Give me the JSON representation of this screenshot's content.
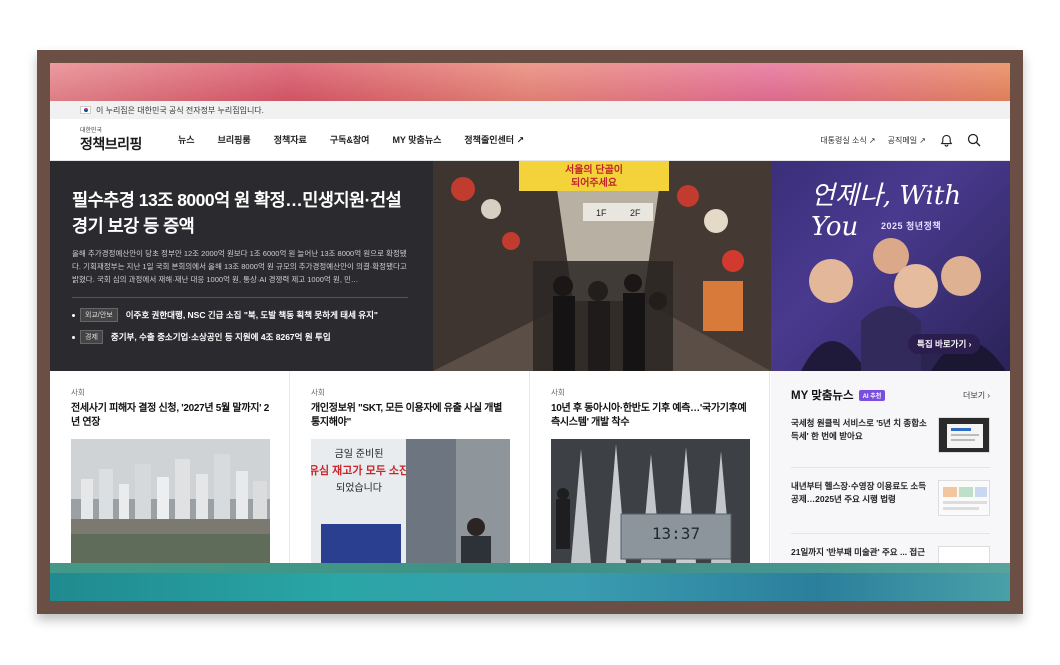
{
  "gov_bar": {
    "notice": "이 누리집은 대한민국 공식 전자정부 누리집입니다."
  },
  "header": {
    "logo_small": "대한민국",
    "logo_main": "정책브리핑",
    "nav": [
      "뉴스",
      "브리핑룸",
      "정책자료",
      "구독&참여",
      "MY 맞춤뉴스",
      "정책줄인센터 ↗"
    ],
    "right_links": [
      "대통령실 소식 ↗",
      "공직메일 ↗"
    ]
  },
  "hero": {
    "title": "필수추경 13조 8000억 원 확정…민생지원·건설경기 보강 등 증액",
    "summary": "올해 추가경정예산안이 당초 정부안 12조 2000억 원보다 1조 6000억 원 늘어난 13조 8000억 원으로 확정됐다. 기획재정부는 지난 1일 국회 본회의에서 올해 13조 8000억 원 규모의 추가경정예산안이 의결·확정됐다고 밝혔다. 국회 심의 과정에서 재해·재난 대응 1000억 원, 통상·AI 경쟁력 제고 1000억 원, 민…",
    "news": [
      {
        "tag": "외교/안보",
        "text": "이주호 권한대행, NSC 긴급 소집 \"북, 도발 책동 획책 못하게 태세 유지\""
      },
      {
        "tag": "경제",
        "text": "중기부, 수출 중소기업·소상공인 등 지원에 4조 8267억 원 투입"
      }
    ],
    "photo_signs": [
      "서울의 단골이 되어주세요",
      "1F",
      "2F"
    ],
    "banner_script": "언제나, With You",
    "banner_sub": "2025 청년정책",
    "banner_button": "특집 바로가기 ›"
  },
  "cards": [
    {
      "category": "사회",
      "title": "전세사기 피해자 결정 신청, '2027년 5월 말까지' 2년 연장"
    },
    {
      "category": "사회",
      "title": "개인정보위 \"SKT, 모든 이용자에 유출 사실 개별 통지해야\""
    },
    {
      "category": "사회",
      "title": "10년 후 동아시아·한반도 기후 예측…'국가기후예측시스템' 개발 착수"
    }
  ],
  "card2_sign": [
    "금일 준비된",
    "유심 재고가 모두 소진",
    "되었습니다"
  ],
  "card3_clock": "13:37",
  "my_news": {
    "title": "MY 맞춤뉴스",
    "badge": "AI 추천",
    "more": "더보기 ›",
    "items": [
      "국세청 원클릭 서비스로 '5년 치 종합소득세' 한 번에 받아요",
      "내년부터 헬스장·수영장 이용료도 소득공제…2025년 주요 시행 법령",
      "21일까지 '반부패 미술관' 주요 ... 접근"
    ]
  },
  "colors": {
    "hero_bg": "#2b2b2f",
    "accent_red": "#d9262c",
    "ai_purple": "#7a4ee0",
    "frame": "#6b4f44"
  }
}
